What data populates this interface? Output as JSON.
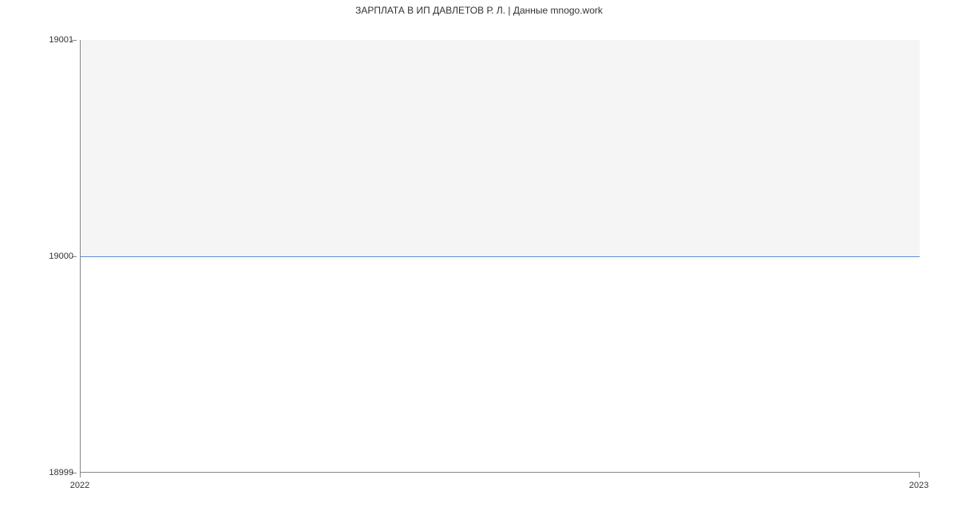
{
  "chart_data": {
    "type": "line",
    "title": "ЗАРПЛАТА В ИП ДАВЛЕТОВ Р. Л. | Данные mnogo.work",
    "x": [
      "2022",
      "2023"
    ],
    "values": [
      19000,
      19000
    ],
    "xlabel": "",
    "ylabel": "",
    "ylim": [
      18999,
      19001
    ],
    "y_ticks": [
      18999,
      19000,
      19001
    ],
    "x_ticks": [
      "2022",
      "2023"
    ],
    "fill_to": 19001,
    "line_color": "#5b8fd6",
    "fill_color": "rgba(0,0,0,0.04)"
  }
}
